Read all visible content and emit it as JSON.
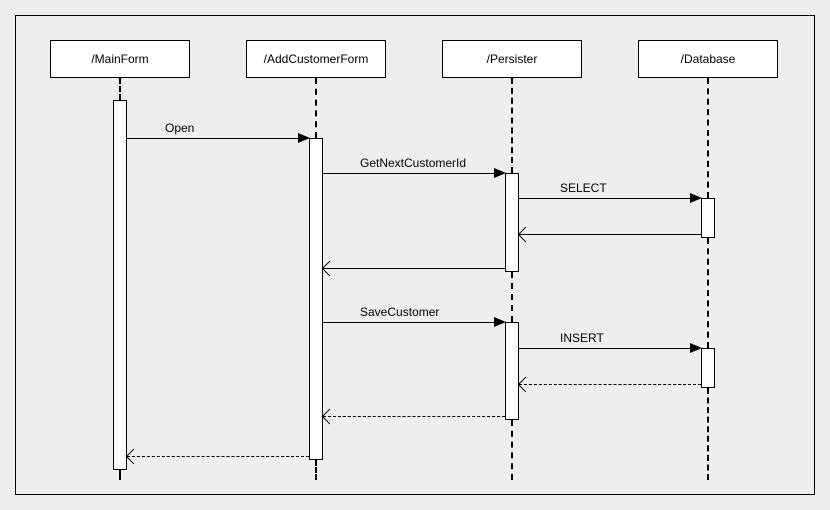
{
  "diagram": {
    "type": "uml-sequence",
    "lifelines": [
      {
        "id": "mainform",
        "label": "/MainForm"
      },
      {
        "id": "addcustomerform",
        "label": "/AddCustomerForm"
      },
      {
        "id": "persister",
        "label": "/Persister"
      },
      {
        "id": "database",
        "label": "/Database"
      }
    ],
    "messages": [
      {
        "id": "open",
        "from": "mainform",
        "to": "addcustomerform",
        "label": "Open",
        "style": "solid",
        "return": false
      },
      {
        "id": "getnextid",
        "from": "addcustomerform",
        "to": "persister",
        "label": "GetNextCustomerId",
        "style": "solid",
        "return": false
      },
      {
        "id": "select",
        "from": "persister",
        "to": "database",
        "label": "SELECT",
        "style": "solid",
        "return": false
      },
      {
        "id": "select-return",
        "from": "database",
        "to": "persister",
        "label": "",
        "style": "solid",
        "return": true
      },
      {
        "id": "getnextid-return",
        "from": "persister",
        "to": "addcustomerform",
        "label": "",
        "style": "solid",
        "return": true
      },
      {
        "id": "savecustomer",
        "from": "addcustomerform",
        "to": "persister",
        "label": "SaveCustomer",
        "style": "solid",
        "return": false
      },
      {
        "id": "insert",
        "from": "persister",
        "to": "database",
        "label": "INSERT",
        "style": "solid",
        "return": false
      },
      {
        "id": "insert-return",
        "from": "database",
        "to": "persister",
        "label": "",
        "style": "dashed",
        "return": true
      },
      {
        "id": "save-return",
        "from": "persister",
        "to": "addcustomerform",
        "label": "",
        "style": "dashed",
        "return": true
      },
      {
        "id": "open-return",
        "from": "addcustomerform",
        "to": "mainform",
        "label": "",
        "style": "dashed",
        "return": true
      }
    ]
  }
}
